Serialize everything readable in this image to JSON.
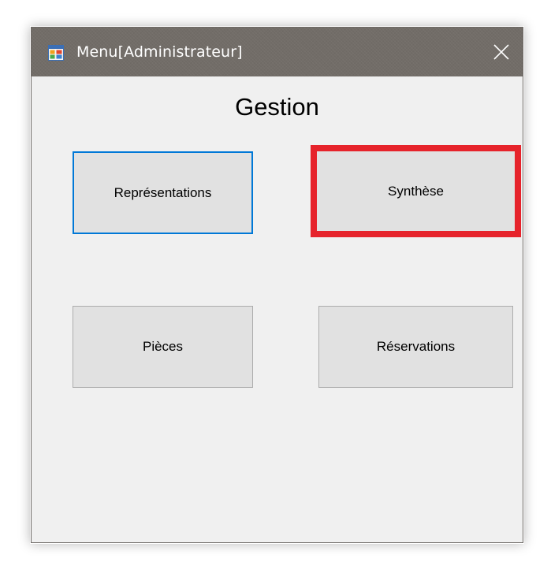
{
  "window": {
    "title": "Menu[Administrateur]",
    "icon": "windows-form-icon",
    "close_icon": "close-icon"
  },
  "main": {
    "heading": "Gestion",
    "buttons": {
      "representations": "Représentations",
      "synthese": "Synthèse",
      "pieces": "Pièces",
      "reservations": "Réservations"
    }
  },
  "colors": {
    "titlebar": "#726d68",
    "form_background": "#f0f0f0",
    "button_face": "#e1e1e1",
    "focus_border": "#0078d7",
    "highlight_border": "#e6232b"
  }
}
